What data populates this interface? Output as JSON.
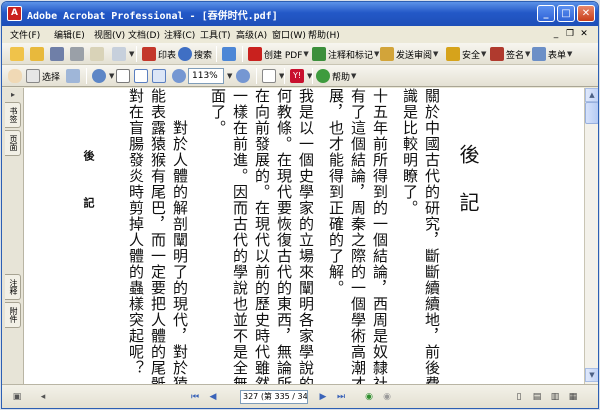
{
  "window": {
    "title": "Adobe Acrobat Professional - [吞併时代.pdf]",
    "app_icon_letter": "A",
    "minimize": "_",
    "maximize": "□",
    "close": "✕"
  },
  "menu": {
    "items": [
      "文件(F)",
      "编辑(E)",
      "视图(V)",
      "文档(D)",
      "注释(C)",
      "工具(T)",
      "高级(A)",
      "窗口(W)",
      "帮助(H)"
    ],
    "doc_controls": [
      "_",
      "❐",
      "✕"
    ]
  },
  "toolbar1": {
    "print_label": "印表",
    "search_label": "搜索",
    "create_pdf": "创建 PDF",
    "review_comment": "注释和标记",
    "send_review": "发送审阅",
    "secure": "安全",
    "sign": "签名",
    "forms": "表单"
  },
  "toolbar2": {
    "select_label": "选择",
    "zoom_value": "113%",
    "help_label": "帮助"
  },
  "sidenav": {
    "tab_bookmarks": "书签",
    "tab_pages": "页面",
    "tab_comments": "注释",
    "tab_attachments": "附件"
  },
  "document": {
    "heading": "後記",
    "signature": "後記",
    "columns": [
      "關於中國古代的研究，斷斷續續地，前後費",
      "識是比較明瞭了。",
      "十五年前所得到的一個結論，西周是奴隸社",
      "有了這個結論，周秦之際的一個學術高潮才",
      "展，也才能得到正確的了解。",
      "我是以一個史學家的立場來闡明各家學說的",
      "何教條。在現代要恢復古代的東西，無論所恢復",
      "在向前發展的。在現代以前的歷史時代雖然都是",
      "一樣在前進。因而古代的學說也並不是全無可取",
      "面了。",
      "對於人體的解剖闡明了的現代，對於猿猴乃",
      "能表露猿猴有尾巴，而一定要把人體的尾骶骨跨",
      "對在盲腸發炎時剪掉人體的蟲樣突起呢？"
    ]
  },
  "statusbar": {
    "page_display": "327 (第 335 / 342 页)"
  },
  "colors": {
    "titlebar": "#2358c7",
    "chrome": "#ece9d8",
    "page": "#ffffff"
  }
}
